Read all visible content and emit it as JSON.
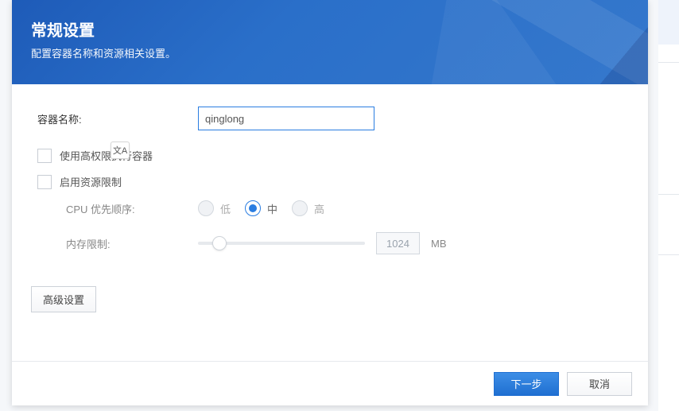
{
  "header": {
    "title": "常规设置",
    "subtitle": "配置容器名称和资源相关设置。"
  },
  "form": {
    "container_name_label": "容器名称:",
    "container_name_value": "qinglong",
    "high_privilege_label": "使用高权限执行容器",
    "enable_resource_limit_label": "启用资源限制",
    "cpu_priority_label": "CPU 优先顺序:",
    "memory_limit_label": "内存限制:",
    "cpu_options": {
      "low": "低",
      "mid": "中",
      "high": "高"
    },
    "cpu_selected": "mid",
    "memory_limit_value": "1024",
    "memory_unit": "MB"
  },
  "translate_icon": "文A",
  "buttons": {
    "advanced": "高级设置",
    "next": "下一步",
    "cancel": "取消"
  }
}
